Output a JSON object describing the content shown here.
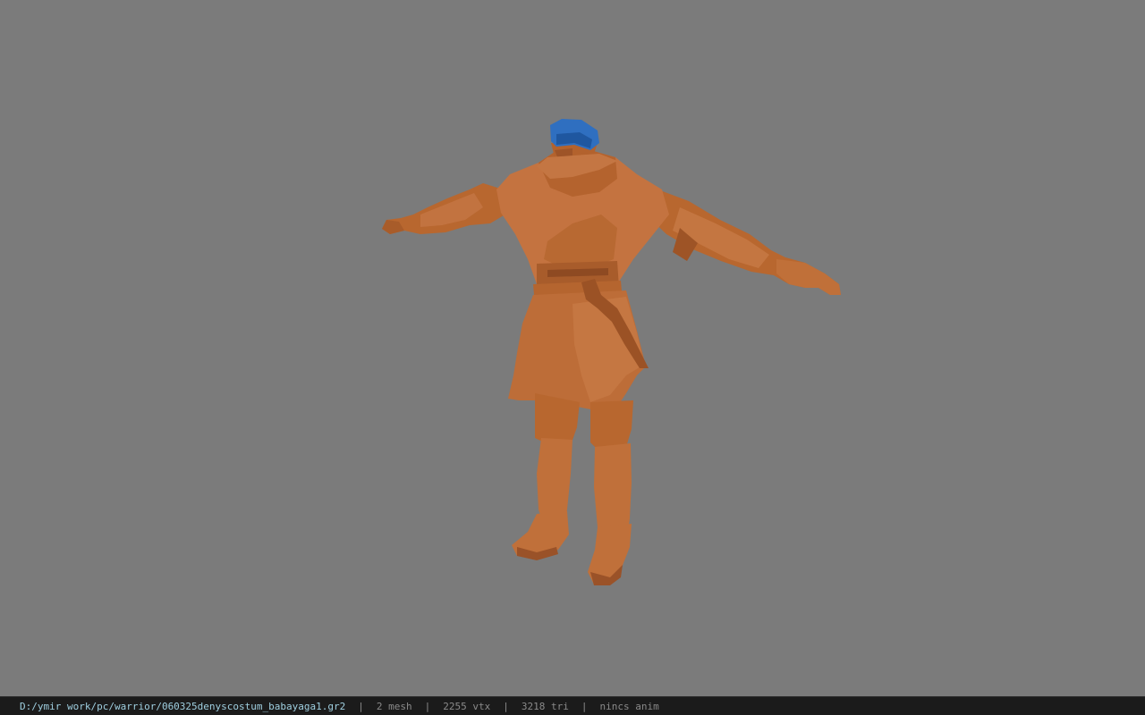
{
  "viewport": {
    "background": "#7b7b7b",
    "model_colors": {
      "body": "#c0703a",
      "shadow": "#9a5228",
      "highlight": "#cf7e45",
      "headband": "#2f6fc0"
    }
  },
  "statusbar": {
    "file_path": "D:/ymir work/pc/warrior/060325denyscostum_babayaga1.gr2",
    "separator": "|",
    "mesh_count": "2 mesh",
    "vertex_count": "2255 vtx",
    "triangle_count": "3218 tri",
    "anim_status": "nincs anim"
  }
}
